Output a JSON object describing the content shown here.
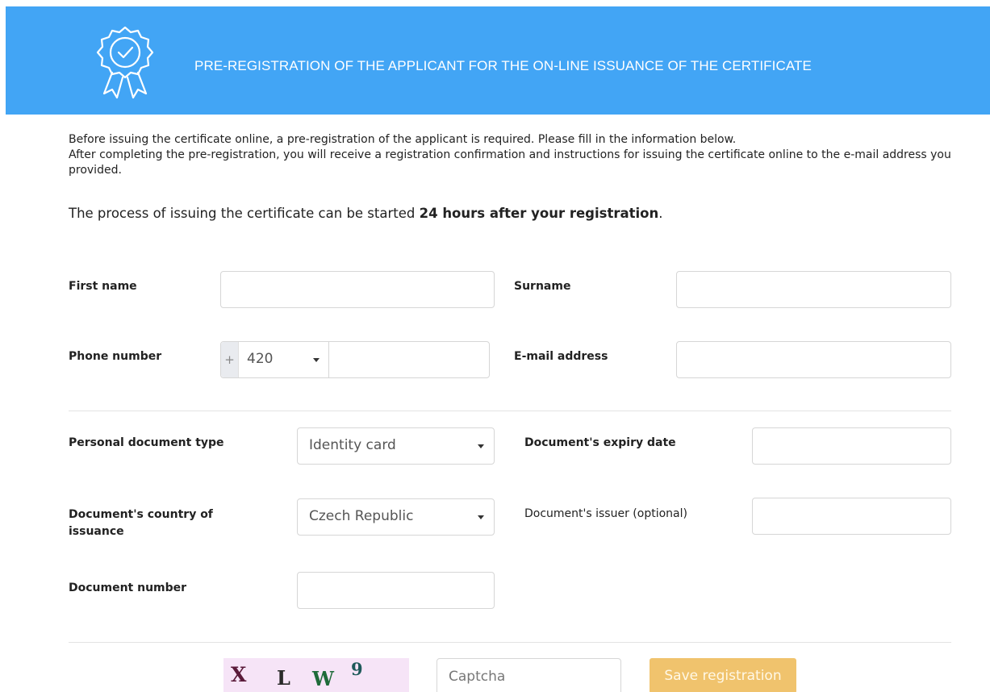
{
  "header": {
    "title": "PRE-REGISTRATION OF THE APPLICANT FOR THE ON-LINE ISSUANCE OF THE CERTIFICATE",
    "icon": "certificate-badge-icon",
    "background": "#42a5f5"
  },
  "intro": {
    "line1": "Before issuing the certificate online, a pre-registration of the applicant is required. Please fill in the information below.",
    "line2": "After completing the pre-registration, you will receive a registration confirmation and instructions for issuing the certificate online to the e-mail address you provided."
  },
  "notice": {
    "prefix": "The process of issuing the certificate can be started ",
    "bold": "24 hours after your registration",
    "suffix": "."
  },
  "form": {
    "first_name": {
      "label": "First name",
      "value": ""
    },
    "surname": {
      "label": "Surname",
      "value": ""
    },
    "phone": {
      "label": "Phone number",
      "prefix": "+",
      "code": "420",
      "value": ""
    },
    "email": {
      "label": "E-mail address",
      "value": ""
    },
    "doc_type": {
      "label": "Personal document type",
      "selected": "Identity card"
    },
    "doc_expiry": {
      "label": "Document's expiry date",
      "value": ""
    },
    "doc_country": {
      "label": "Document's country of issuance",
      "selected": "Czech Republic"
    },
    "doc_issuer": {
      "label": "Document's issuer (optional)",
      "value": ""
    },
    "doc_number": {
      "label": "Document number",
      "value": ""
    }
  },
  "captcha": {
    "chars": [
      "X",
      "L",
      "W",
      "9"
    ],
    "colors": [
      "#5a1a3a",
      "#2a2a2a",
      "#1f6b3a",
      "#1e5a5a"
    ],
    "input_placeholder": "Captcha"
  },
  "actions": {
    "save_label": "Save registration",
    "save_color": "#f0c36d"
  }
}
